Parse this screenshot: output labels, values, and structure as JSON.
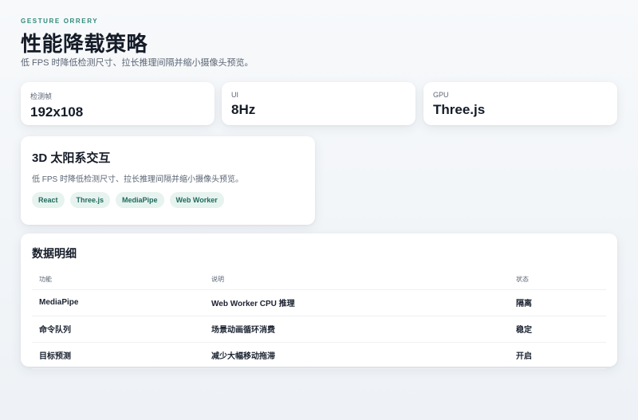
{
  "header": {
    "eyebrow": "GESTURE ORRERY",
    "title": "性能降载策略",
    "subtitle": "低 FPS 时降低检测尺寸、拉长推理间隔并缩小摄像头预览。"
  },
  "stats": [
    {
      "label": "检测帧",
      "value": "192x108"
    },
    {
      "label": "UI",
      "value": "8Hz"
    },
    {
      "label": "GPU",
      "value": "Three.js"
    }
  ],
  "feature": {
    "title": "3D 太阳系交互",
    "description": "低 FPS 时降低检测尺寸、拉长推理间隔并缩小摄像头预览。",
    "tags": [
      "React",
      "Three.js",
      "MediaPipe",
      "Web Worker"
    ]
  },
  "table": {
    "title": "数据明细",
    "columns": [
      "功能",
      "说明",
      "状态"
    ],
    "rows": [
      [
        "MediaPipe",
        "Web Worker CPU 推理",
        "隔离"
      ],
      [
        "命令队列",
        "场景动画循环消费",
        "稳定"
      ],
      [
        "目标预测",
        "减少大幅移动拖滞",
        "开启"
      ]
    ]
  }
}
